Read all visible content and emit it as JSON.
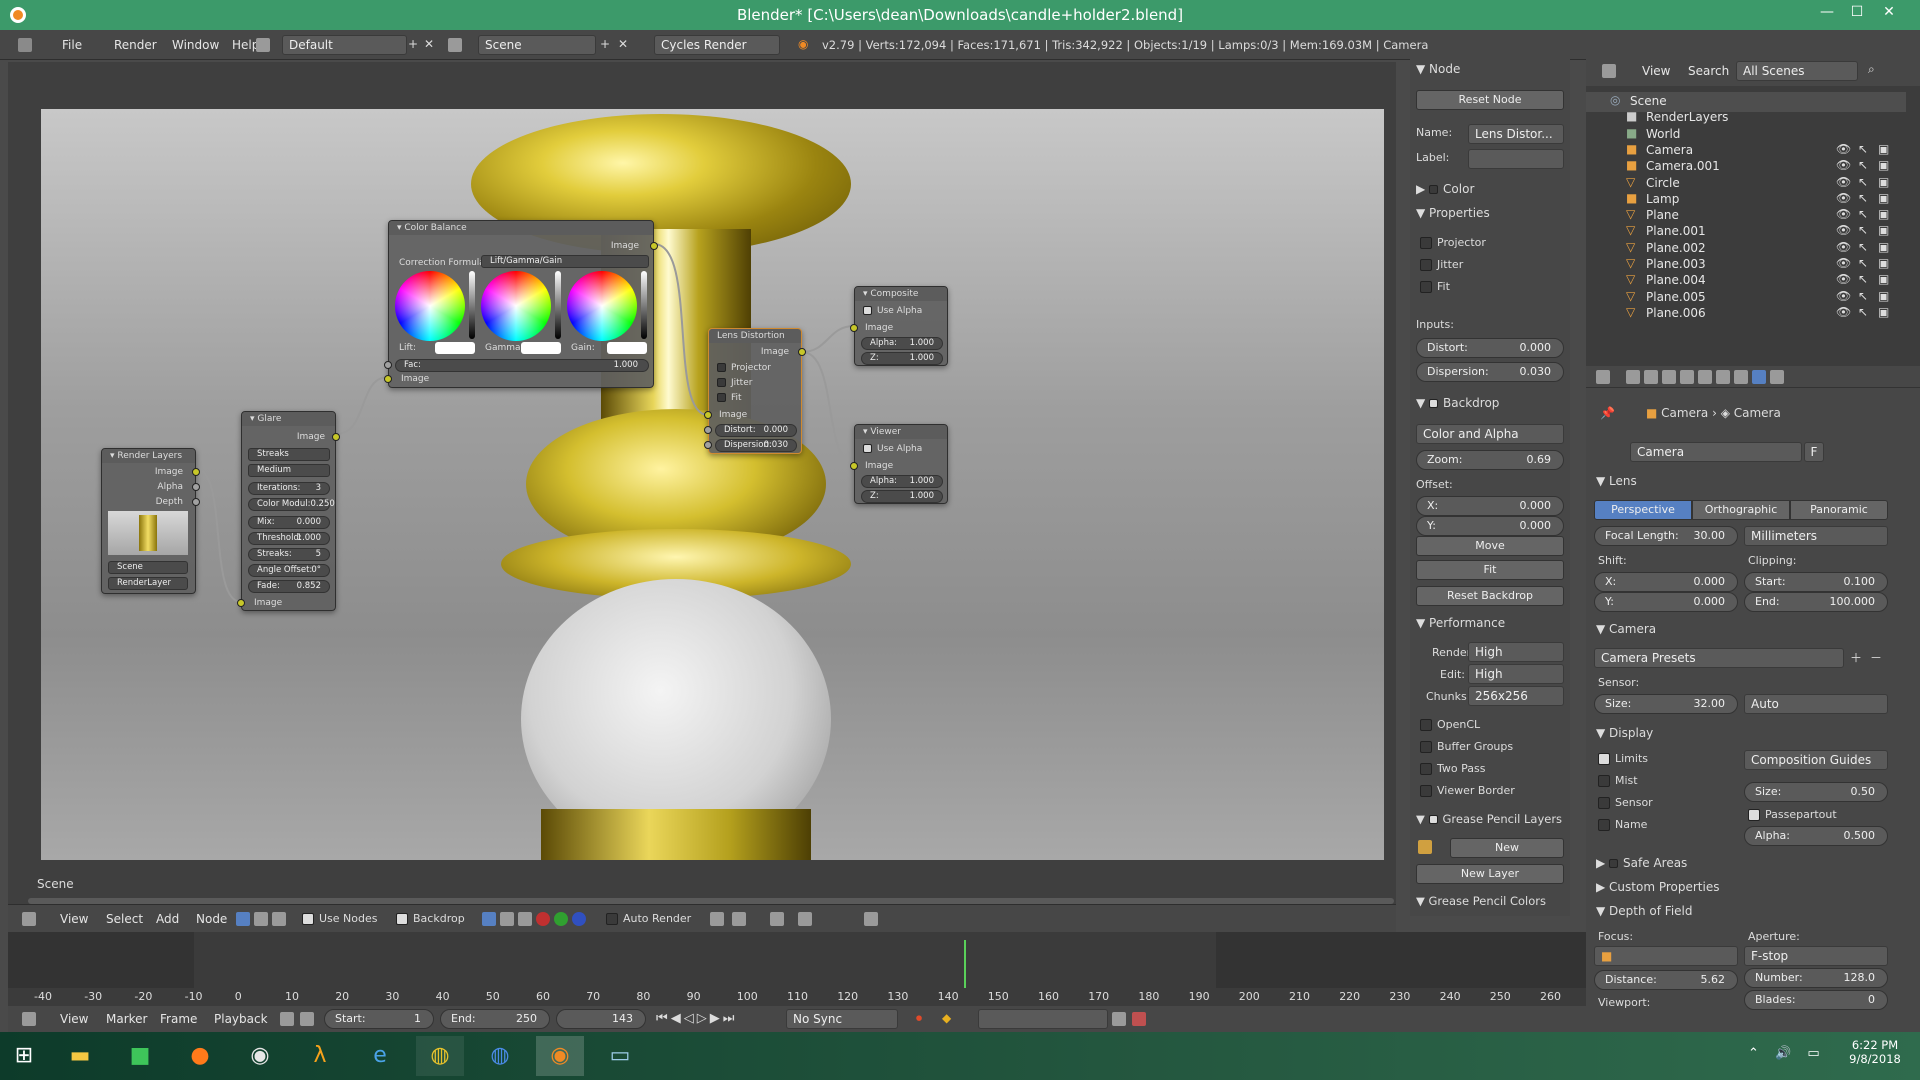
{
  "window": {
    "title": "Blender* [C:\\Users\\dean\\Downloads\\candle+holder2.blend]"
  },
  "infobar": {
    "menus": [
      "File",
      "Render",
      "Window",
      "Help"
    ],
    "layout": "Default",
    "scene": "Scene",
    "engine": "Cycles Render",
    "stats": "v2.79 | Verts:172,094 | Faces:171,671 | Tris:342,922 | Objects:1/19 | Lamps:0/3 | Mem:169.03M | Camera"
  },
  "viewport": {
    "scene_label": "Scene"
  },
  "nodes": {
    "color_balance": {
      "title": "Color Balance",
      "out": "Image",
      "formula_label": "Correction Formula:",
      "formula": "Lift/Gamma/Gain",
      "lift": "Lift:",
      "gamma": "Gamma:",
      "gain": "Gain:",
      "fac_label": "Fac:",
      "fac": "1.000",
      "in": "Image"
    },
    "glare": {
      "title": "Glare",
      "out": "Image",
      "type": "Streaks",
      "quality": "Medium",
      "iter_label": "Iterations:",
      "iter": "3",
      "cm_label": "Color Modul:",
      "cm": "0.250",
      "mix_label": "Mix:",
      "mix": "0.000",
      "thr_label": "Threshold:",
      "thr": "1.000",
      "str_label": "Streaks:",
      "str": "5",
      "ao_label": "Angle Offset:",
      "ao": "0°",
      "fade_label": "Fade:",
      "fade": "0.852",
      "in": "Image"
    },
    "render_layers": {
      "title": "Render Layers",
      "out1": "Image",
      "out2": "Alpha",
      "out3": "Depth",
      "scene": "Scene",
      "layer": "RenderLayer"
    },
    "lens": {
      "title": "Lens Distortion",
      "out": "Image",
      "c1": "Projector",
      "c2": "Jitter",
      "c3": "Fit",
      "in": "Image",
      "d_label": "Distort:",
      "d": "0.000",
      "disp_label": "Dispersion:",
      "disp": "0.030"
    },
    "composite": {
      "title": "Composite",
      "alpha_chk": "Use Alpha",
      "in": "Image",
      "a_label": "Alpha:",
      "a": "1.000",
      "z_label": "Z:",
      "z": "1.000"
    },
    "viewer": {
      "title": "Viewer",
      "alpha_chk": "Use Alpha",
      "in": "Image",
      "a_label": "Alpha:",
      "a": "1.000",
      "z_label": "Z:",
      "z": "1.000"
    }
  },
  "nodehdr": {
    "menus": [
      "View",
      "Select",
      "Add",
      "Node"
    ],
    "use_nodes": "Use Nodes",
    "backdrop": "Backdrop",
    "auto_render": "Auto Render"
  },
  "timeline": {
    "ticks": [
      "-40",
      "-30",
      "-20",
      "-10",
      "0",
      "10",
      "20",
      "30",
      "40",
      "50",
      "60",
      "70",
      "80",
      "90",
      "100",
      "110",
      "120",
      "130",
      "140",
      "150",
      "160",
      "170",
      "180",
      "190",
      "200",
      "210",
      "220",
      "230",
      "240",
      "250",
      "260"
    ],
    "menus": [
      "View",
      "Marker",
      "Frame",
      "Playback"
    ],
    "start_label": "Start:",
    "start": "1",
    "end_label": "End:",
    "end": "250",
    "current": "143",
    "sync": "No Sync",
    "current_frame_value": 143
  },
  "npanel": {
    "node_hdr": "Node",
    "reset": "Reset Node",
    "name_label": "Name:",
    "name": "Lens Distor...",
    "label_label": "Label:",
    "color": "Color",
    "properties": "Properties",
    "p1": "Projector",
    "p2": "Jitter",
    "p3": "Fit",
    "inputs": "Inputs:",
    "distort_label": "Distort:",
    "distort": "0.000",
    "disp_label": "Dispersion:",
    "disp": "0.030",
    "backdrop": "Backdrop",
    "mode": "Color and Alpha",
    "zoom_label": "Zoom:",
    "zoom": "0.69",
    "offset": "Offset:",
    "x_label": "X:",
    "x": "0.000",
    "y_label": "Y:",
    "y": "0.000",
    "move": "Move",
    "fit": "Fit",
    "reset_backdrop": "Reset Backdrop",
    "performance": "Performance",
    "render_label": "Render:",
    "render": "High",
    "edit_label": "Edit:",
    "edit": "High",
    "chunks_label": "Chunks",
    "chunks": "256x256",
    "opencl": "OpenCL",
    "buffer": "Buffer Groups",
    "twopass": "Two Pass",
    "border": "Viewer Border",
    "gp_layers": "Grease Pencil Layers",
    "new": "New",
    "new_layer": "New Layer",
    "gp_colors": "Grease Pencil Colors"
  },
  "outliner": {
    "menus": [
      "View",
      "Search"
    ],
    "filter": "All Scenes",
    "items": [
      "Scene",
      "RenderLayers",
      "World",
      "Camera",
      "Camera.001",
      "Circle",
      "Lamp",
      "Plane",
      "Plane.001",
      "Plane.002",
      "Plane.003",
      "Plane.004",
      "Plane.005",
      "Plane.006"
    ]
  },
  "props": {
    "crumb1": "Camera",
    "crumb2": "Camera",
    "datablock": "Camera",
    "fake": "F",
    "lens": "Lens",
    "tabs": [
      "Perspective",
      "Orthographic",
      "Panoramic"
    ],
    "focal_label": "Focal Length:",
    "focal": "30.00",
    "units": "Millimeters",
    "shift": "Shift:",
    "sx_label": "X:",
    "sx": "0.000",
    "sy_label": "Y:",
    "sy": "0.000",
    "clipping": "Clipping:",
    "start_label": "Start:",
    "start": "0.100",
    "end_label": "End:",
    "end": "100.000",
    "camera": "Camera",
    "presets": "Camera Presets",
    "sensor": "Sensor:",
    "size_label": "Size:",
    "size": "32.00",
    "fit": "Auto",
    "display": "Display",
    "limits": "Limits",
    "mist": "Mist",
    "sensor_chk": "Sensor",
    "name_chk": "Name",
    "guides": "Composition Guides",
    "gsize_label": "Size:",
    "gsize": "0.50",
    "passe": "Passepartout",
    "alpha_label": "Alpha:",
    "alpha": "0.500",
    "safe": "Safe Areas",
    "custom": "Custom Properties",
    "dof": "Depth of Field",
    "focus": "Focus:",
    "aperture": "Aperture:",
    "fstop": "F-stop",
    "dist_label": "Distance:",
    "dist": "5.62",
    "num_label": "Number:",
    "num": "128.0",
    "viewport": "Viewport:",
    "blades_label": "Blades:",
    "blades": "0"
  },
  "taskbar": {
    "time": "6:22 PM",
    "date": "9/8/2018"
  },
  "colors": {
    "accent": "#3c9a6a",
    "selected_tab": "#5680c2",
    "socket_yellow": "#c7c729"
  }
}
